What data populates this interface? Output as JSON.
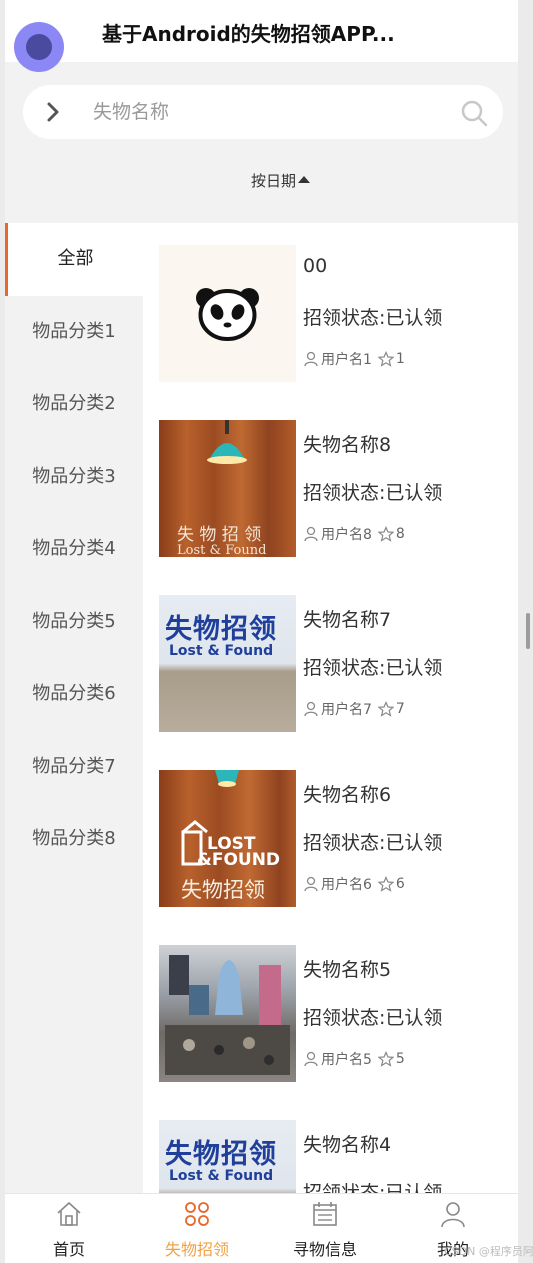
{
  "header": {
    "title": "基于Android的失物招领APP..."
  },
  "search": {
    "placeholder": "失物名称"
  },
  "sort": {
    "label": "按日期"
  },
  "sidebar": {
    "items": [
      {
        "label": "全部",
        "active": true
      },
      {
        "label": "物品分类1"
      },
      {
        "label": "物品分类2"
      },
      {
        "label": "物品分类3"
      },
      {
        "label": "物品分类4"
      },
      {
        "label": "物品分类5"
      },
      {
        "label": "物品分类6"
      },
      {
        "label": "物品分类7"
      },
      {
        "label": "物品分类8"
      }
    ]
  },
  "items": [
    {
      "name": "00",
      "status": "招领状态:已认领",
      "user": "用户名1",
      "count": "1",
      "thumb": "panda"
    },
    {
      "name": "失物名称8",
      "status": "招领状态:已认领",
      "user": "用户名8",
      "count": "8",
      "thumb": "wood-lamp",
      "thumb_text": "失 物 招 领",
      "thumb_sub": "Lost & Found"
    },
    {
      "name": "失物名称7",
      "status": "招领状态:已认领",
      "user": "用户名7",
      "count": "7",
      "thumb": "sign",
      "thumb_text": "失物招领",
      "thumb_sub": "Lost & Found"
    },
    {
      "name": "失物名称6",
      "status": "招领状态:已认领",
      "user": "用户名6",
      "count": "6",
      "thumb": "wood-logo",
      "thumb_logo_top": "LOST",
      "thumb_logo_bottom": "&FOUND",
      "thumb_text": "失物招领"
    },
    {
      "name": "失物名称5",
      "status": "招领状态:已认领",
      "user": "用户名5",
      "count": "5",
      "thumb": "pile"
    },
    {
      "name": "失物名称4",
      "status": "招领状态:已认领",
      "user": "",
      "count": "",
      "thumb": "sign",
      "thumb_text": "失物招领",
      "thumb_sub": "Lost & Found"
    }
  ],
  "tabs": [
    {
      "label": "首页",
      "icon": "home-icon"
    },
    {
      "label": "失物招领",
      "icon": "clover-icon",
      "active": true
    },
    {
      "label": "寻物信息",
      "icon": "calendar-icon"
    },
    {
      "label": "我的",
      "icon": "user-icon"
    }
  ],
  "colors": {
    "accent": "#e8672e",
    "tab_active": "#f0a246",
    "fab": "#8b88f5"
  },
  "watermark": "CSDN @程序员阿龙"
}
